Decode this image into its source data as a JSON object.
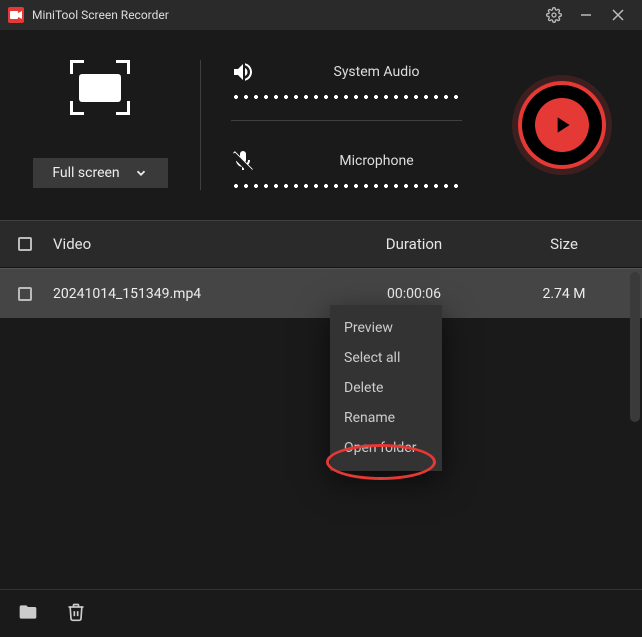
{
  "app": {
    "title": "MiniTool Screen Recorder"
  },
  "capture": {
    "mode_label": "Full screen"
  },
  "audio": {
    "system_label": "System Audio",
    "mic_label": "Microphone"
  },
  "table": {
    "col_video": "Video",
    "col_duration": "Duration",
    "col_size": "Size",
    "rows": [
      {
        "name": "20241014_151349.mp4",
        "duration": "00:00:06",
        "size": "2.74 M"
      }
    ]
  },
  "context_menu": {
    "preview": "Preview",
    "select_all": "Select all",
    "delete": "Delete",
    "rename": "Rename",
    "open_folder": "Open folder"
  }
}
